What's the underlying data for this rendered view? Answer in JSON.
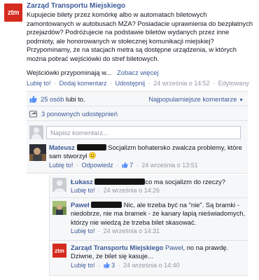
{
  "post": {
    "page_name": "Zarząd Transportu Miejskiego",
    "logo_text": "ztm",
    "body": "Kupujecie bilety przez komórkę albo w automatach biletowych zamontowanych w autobusach MZA? Posiadacie uprawnienia do bezpłatnych przejazdów? Podróżujecie na podstawie biletów wydanych przez inne podmioty, ale honorowanych w stołecznej komunikacji miejskiej? Przypominamy, że na stacjach metra są dostępne urządzenia, w których można pobrać wejściówki do stref biletowych.",
    "footnote": "Wejściówki przypominają w...",
    "see_more": "Zobacz więcej",
    "actions": {
      "like": "Lubię to!",
      "comment": "Dodaj komentarz",
      "share": "Udostępnij",
      "date": "24 września o 14:52",
      "edited": "Edytowany"
    }
  },
  "ufi": {
    "likes_count": "25 osób",
    "likes_suffix": " lubi to.",
    "sort_label": "Najpopularniejsze komentarze",
    "shares": "3 ponownych udostępnień",
    "input_placeholder": "Napisz komentarz..."
  },
  "comments": [
    {
      "name": "Mateusz",
      "text": "Socjalizm bohatersko zwalcza problemy, które sam stworzył",
      "like": "Lubię to!",
      "reply": "Odpowiedz",
      "likes": "7",
      "date": "24 września o 13:51"
    }
  ],
  "replies": [
    {
      "name": "Łukasz",
      "text": "co ma socjalizm do rzeczy?",
      "like": "Lubię to!",
      "date": "24 września o 14:26"
    },
    {
      "name": "Paweł",
      "text": "Nic, ale trzeba być na \"nie\". Są bramki - niedobrze, nie ma bramek - że kanary łapią nieświadomych, którzy nie wiedzą że trzeba bilet skasować.",
      "like": "Lubię to!",
      "date": "24 września o 14:31"
    },
    {
      "name": "Zarząd Transportu Miejskiego",
      "text_prefix": "Paweł",
      "text": ", no na prawdę. Dziwne, że bilet się kasuje...",
      "like": "Lubię to!",
      "likes": "3",
      "date": "24 września o 14:40"
    }
  ],
  "colors": {
    "brand_red": "#d52b1e",
    "link_blue": "#3b5998",
    "muted": "#9197a3",
    "panel_bg": "#f6f7f8"
  }
}
